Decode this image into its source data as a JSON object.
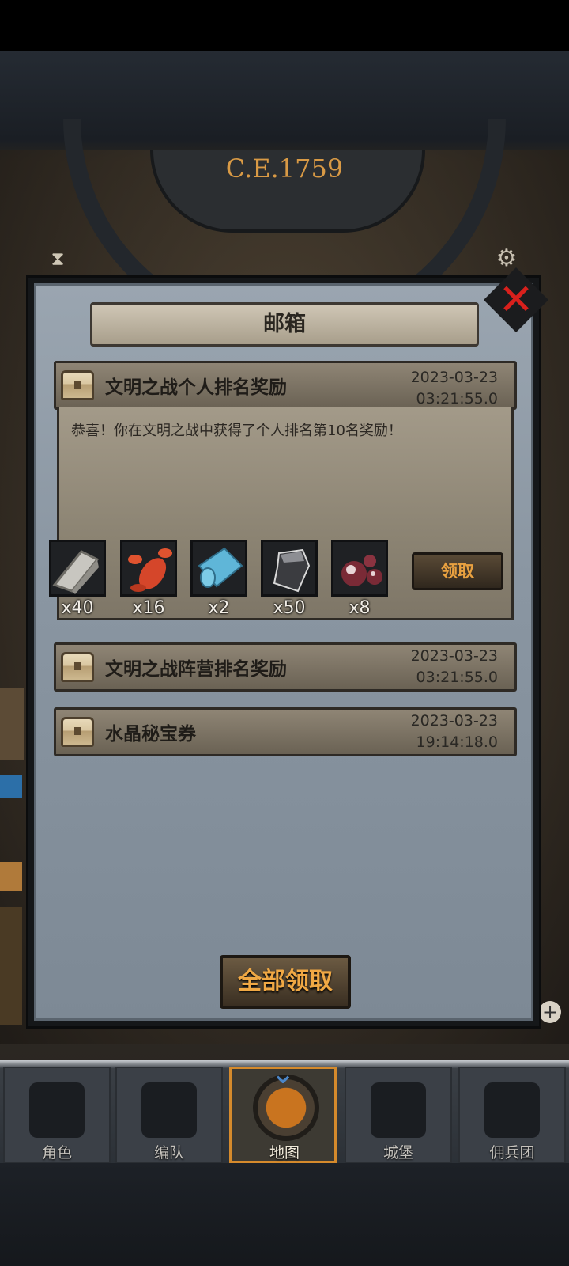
{
  "topbar": {
    "era": "C.E.1759"
  },
  "mailbox": {
    "title": "邮箱",
    "mails": [
      {
        "title": "文明之战个人排名奖励",
        "date": "2023-03-23",
        "time": "03:21:55.0"
      },
      {
        "title": "文明之战阵营排名奖励",
        "date": "2023-03-23",
        "time": "03:21:55.0"
      },
      {
        "title": "水晶秘宝券",
        "date": "2023-03-23",
        "time": "19:14:18.0"
      }
    ],
    "expanded": {
      "message": "恭喜！你在文明之战中获得了个人排名第10名奖励！",
      "rewards": [
        {
          "icon": "silver-ingot-icon",
          "qty": "x40"
        },
        {
          "icon": "lobster-icon",
          "qty": "x16"
        },
        {
          "icon": "cloth-roll-icon",
          "qty": "x2"
        },
        {
          "icon": "iron-ore-icon",
          "qty": "x50"
        },
        {
          "icon": "pearls-icon",
          "qty": "x8"
        }
      ],
      "claim_label": "领取"
    },
    "claim_all_label": "全部领取"
  },
  "nav": {
    "items": [
      {
        "label": "角色",
        "icon": "knight-icon"
      },
      {
        "label": "编队",
        "icon": "helmet-icon"
      },
      {
        "label": "地图",
        "icon": "map-icon",
        "active": true
      },
      {
        "label": "城堡",
        "icon": "castle-icon"
      },
      {
        "label": "佣兵团",
        "icon": "mercenary-icon"
      }
    ]
  }
}
